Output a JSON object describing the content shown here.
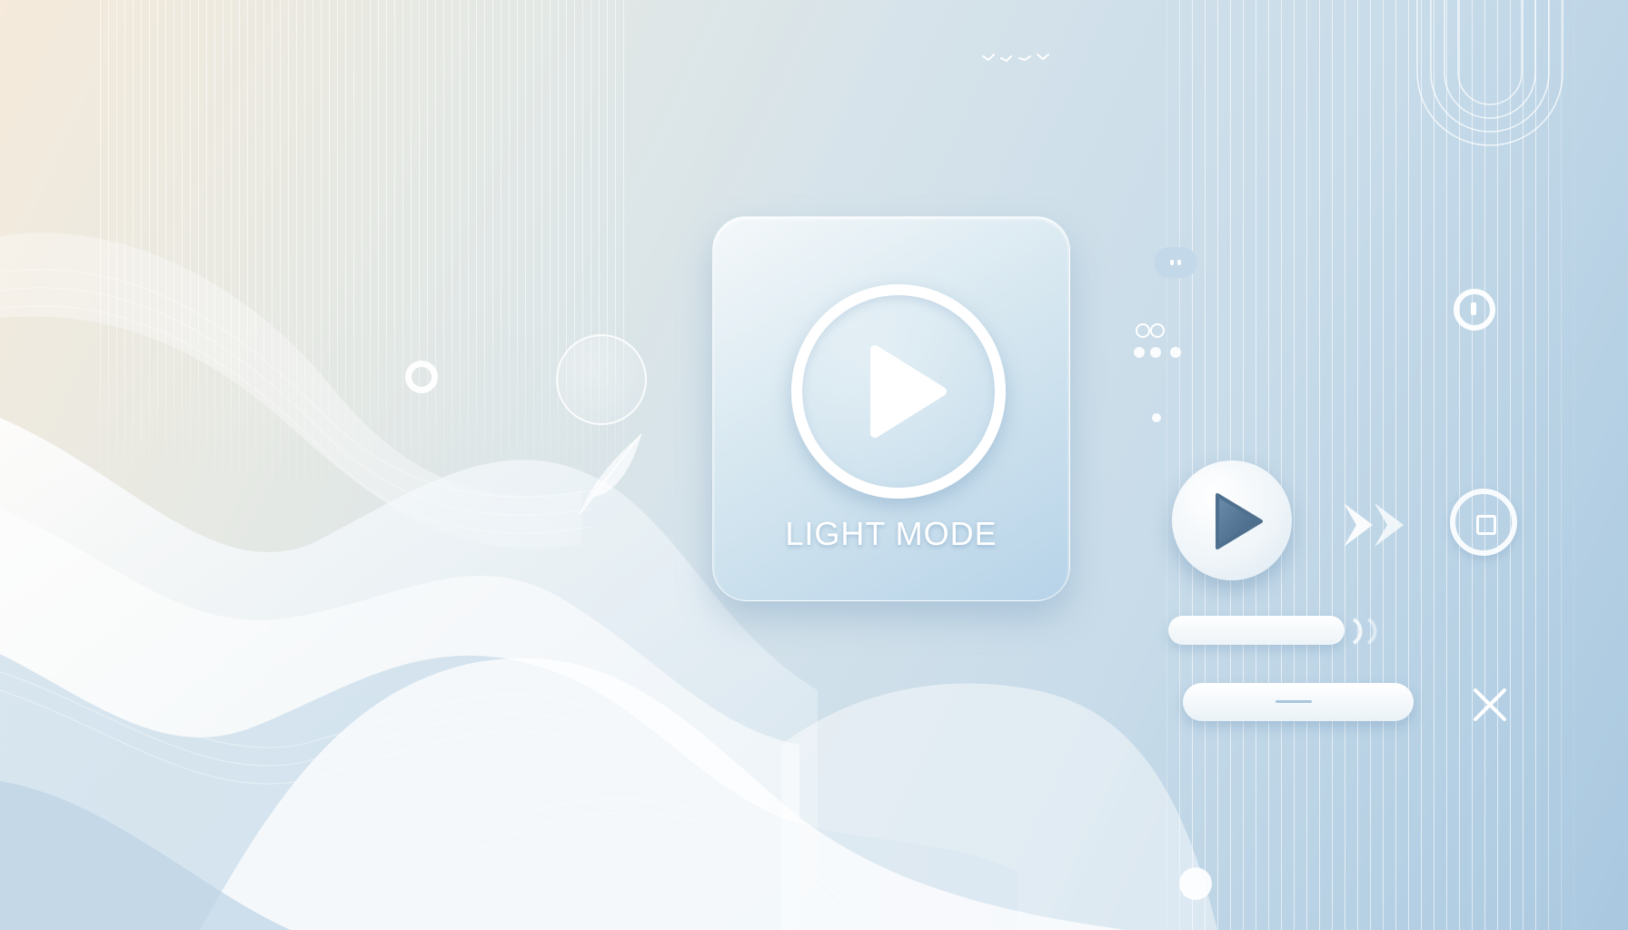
{
  "card": {
    "label": "LIGHT MODE"
  },
  "icons": {
    "main": "play-icon",
    "secondary_play": "play-icon",
    "fast_forward": "fast-forward-icon",
    "stop": "stop-icon",
    "close": "close-icon",
    "info": "info-icon"
  },
  "colors": {
    "accent": "#a9c8e0",
    "card_top": "#f4f8fa",
    "card_bottom": "#b7d3e8",
    "play_triangle": "#4f6f8f",
    "white": "#ffffff"
  }
}
